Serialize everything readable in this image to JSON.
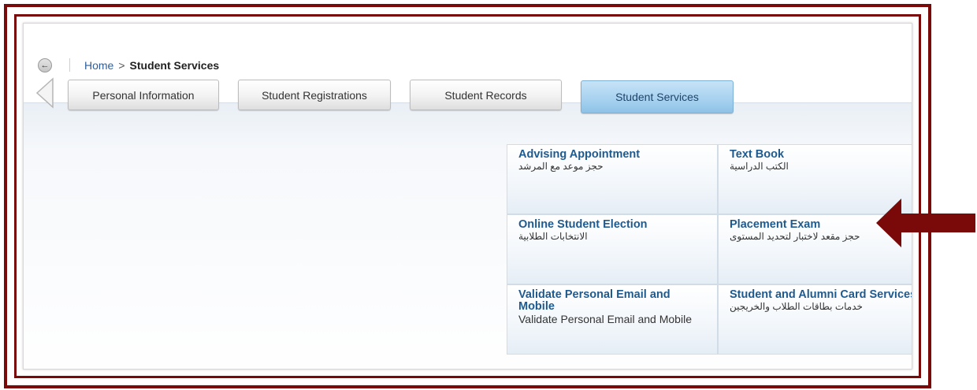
{
  "breadcrumb": {
    "home": "Home",
    "separator": ">",
    "current": "Student Services"
  },
  "tabs": [
    {
      "label": "Personal Information"
    },
    {
      "label": "Student Registrations"
    },
    {
      "label": "Student Records"
    },
    {
      "label": "Student Services",
      "active": true
    }
  ],
  "services": [
    {
      "title": "Advising Appointment",
      "subtitle": "حجز موعد مع المرشد"
    },
    {
      "title": "Text Book",
      "subtitle": "الكتب الدراسية"
    },
    {
      "title": "Online Student Election",
      "subtitle": "الانتخابات الطلابية"
    },
    {
      "title": "Placement Exam",
      "subtitle": "حجز مقعد لاختبار لتحديد المستوى"
    },
    {
      "title": "Validate Personal Email and Mobile",
      "subtitle": "Validate Personal Email and Mobile"
    },
    {
      "title": "Student and Alumni Card Services",
      "subtitle": "خدمات بطاقات الطلاب والخريجين"
    }
  ],
  "icons": {
    "back": "back-arrow-icon",
    "scroll": "scroll-left-icon",
    "pointer": "pointer-arrow"
  },
  "colors": {
    "frame": "#7a0a0a",
    "link": "#1f5a8f",
    "active_tab": "#a6d1ef"
  }
}
